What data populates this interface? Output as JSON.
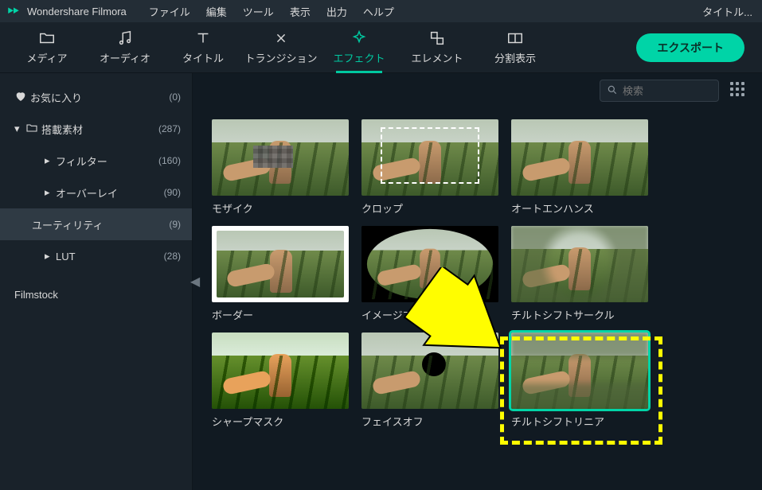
{
  "app": {
    "name": "Wondershare Filmora",
    "project_title": "タイトル..."
  },
  "menubar": {
    "file": "ファイル",
    "edit": "編集",
    "tools": "ツール",
    "view": "表示",
    "output": "出力",
    "help": "ヘルプ"
  },
  "tabs": {
    "media": "メディア",
    "audio": "オーディオ",
    "title": "タイトル",
    "transition": "トランジション",
    "effect": "エフェクト",
    "element": "エレメント",
    "split": "分割表示",
    "export": "エクスポート"
  },
  "sidebar": {
    "favorites": {
      "label": "お気に入り",
      "count": "(0)"
    },
    "builtin": {
      "label": "搭載素材",
      "count": "(287)"
    },
    "filter": {
      "label": "フィルター",
      "count": "(160)"
    },
    "overlay": {
      "label": "オーバーレイ",
      "count": "(90)"
    },
    "utility": {
      "label": "ユーティリティ",
      "count": "(9)"
    },
    "lut": {
      "label": "LUT",
      "count": "(28)"
    },
    "filmstock": {
      "label": "Filmstock"
    }
  },
  "search": {
    "placeholder": "検索"
  },
  "effects": {
    "mosaic": "モザイク",
    "crop": "クロップ",
    "autoenhance": "オートエンハンス",
    "border": "ボーダー",
    "imagemask": "イメージマ...",
    "tiltcircle": "チルトシフトサークル",
    "sharpen": "シャープマスク",
    "faceoff": "フェイスオフ",
    "tiltlinear": "チルトシフトリニア"
  },
  "colors": {
    "accent": "#00d4a7",
    "highlight": "#fffd00"
  }
}
